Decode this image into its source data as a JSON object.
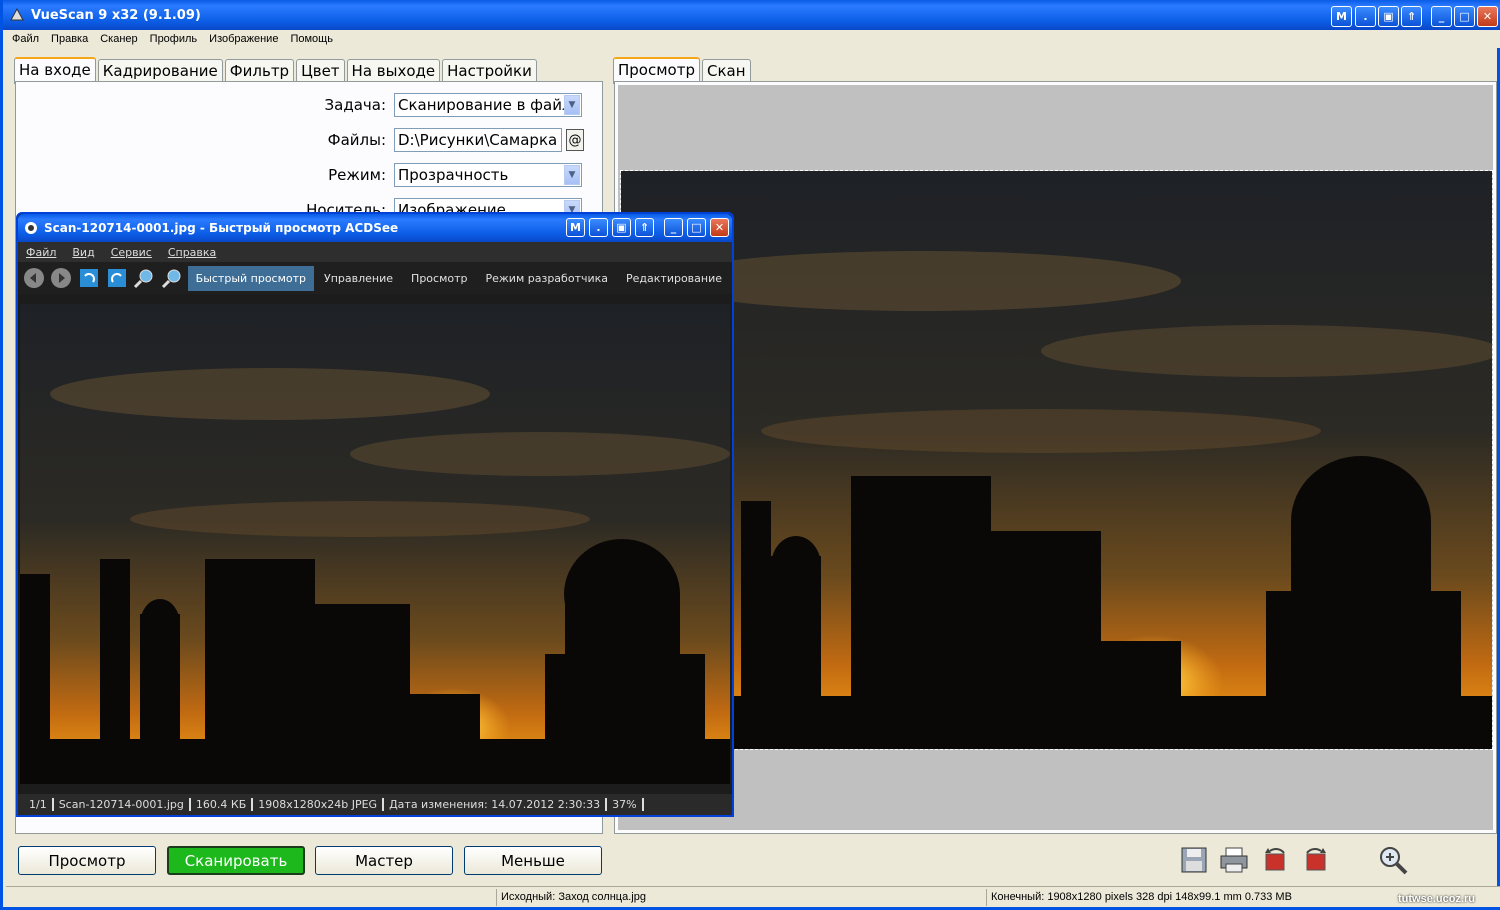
{
  "window": {
    "title": "VueScan 9 x32 (9.1.09)",
    "menu": [
      "Файл",
      "Правка",
      "Сканер",
      "Профиль",
      "Изображение",
      "Помощь"
    ]
  },
  "left_tabs": [
    "На входе",
    "Кадрирование",
    "Фильтр",
    "Цвет",
    "На выходе",
    "Настройки"
  ],
  "form": {
    "task_label": "Задача:",
    "task_value": "Сканирование в файл",
    "files_label": "Файлы:",
    "files_value": "D:\\Рисунки\\Самарка",
    "files_button": "@",
    "mode_label": "Режим:",
    "mode_value": "Прозрачность",
    "media_label": "Носитель:",
    "media_value": "Изображение"
  },
  "right_tabs": [
    "Просмотр",
    "Скан"
  ],
  "bottom_buttons": {
    "preview": "Просмотр",
    "scan": "Сканировать",
    "wizard": "Мастер",
    "less": "Меньше"
  },
  "status": {
    "source": "Исходный: Заход солнца.jpg",
    "output": "Конечный: 1908x1280 pixels 328 dpi 148x99.1 mm 0.733 MB"
  },
  "watermark": "tutwse.ucoz.ru",
  "acdsee": {
    "title": "Scan-120714-0001.jpg - Быстрый просмотр ACDSee",
    "menu": [
      "Файл",
      "Вид",
      "Сервис",
      "Справка"
    ],
    "modes": [
      "Быстрый просмотр",
      "Управление",
      "Просмотр",
      "Режим разработчика",
      "Редактирование"
    ],
    "status": [
      "1/1",
      "Scan-120714-0001.jpg",
      "160.4 КБ",
      "1908x1280x24b JPEG",
      "Дата изменения: 14.07.2012 2:30:33",
      "37%"
    ]
  }
}
